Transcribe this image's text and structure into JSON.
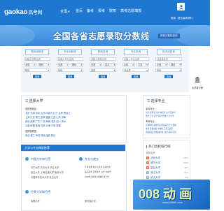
{
  "header": {
    "logo": "gaokao",
    "logo_suffix": "高考网",
    "region": "全国",
    "nav": [
      "首页",
      "备考",
      "报考",
      "院校",
      "高考志愿填报"
    ],
    "links": [
      "登录",
      "提交高考资料"
    ]
  },
  "banner": {
    "title": "全国各省志愿录取分数线",
    "tag": "院校分数线查询"
  },
  "search": {
    "columns": [
      {
        "tab": "院校分数线",
        "input": "请输入院校名称",
        "sel1": "全国",
        "sel2": "理科",
        "sel3": "年份",
        "btn": "查询"
      },
      {
        "tab": "专业分数线",
        "input": "请输入专业名称",
        "sel1": "全国",
        "sel2": "理科",
        "sel3": "年份",
        "btn": "查询"
      },
      {
        "tab": "院校查询",
        "input": "请输入院校名称",
        "sel1": "全国",
        "sel2": "层次",
        "sel3": "类型",
        "btn": "查询"
      },
      {
        "tab": "专业查询",
        "input": "请输入专业名称",
        "sel1": "本科",
        "sel2": "门类",
        "sel3": "专业类",
        "btn": "查询"
      },
      {
        "tab": "批次线查询",
        "input": "请选择省份",
        "sel1": "全国",
        "sel2": "理科",
        "sel3": "年份",
        "btn": "查询"
      }
    ],
    "side_tool_label": "大学排行榜"
  },
  "school_panel": {
    "title": "选择大学",
    "sub1": "按院校地区:",
    "row1": "北京 天津 河北 山西 内蒙古 辽宁 吉林 黑龙江",
    "row2": "上海 江苏 浙江 安徽 福建 江西 山东 河南",
    "row3": "湖北 湖南 广东 广西 海南 重庆 四川 贵州",
    "row4": "云南 西藏 陕西 甘肃 青海 宁夏 新疆",
    "sub2": "按院校类型:",
    "row5": "综合 理工 师范 财经 医药 政法"
  },
  "major_panel": {
    "title": "选择专业",
    "sub1": "本科专业:",
    "row1": "哲学 经济学 法学 教育学 文学 历史学",
    "row2": "理学 工学 农学 医学 管理学 艺术学",
    "sub2": "专科专业:",
    "row3": "农林牧渔 资源环境 能源动力 土木建筑",
    "row4": "水利 装备制造 生物化工 轻工纺织",
    "row5": "食品药品 交通运输 电子信息 医药卫生"
  },
  "section": {
    "title": "大学与专业精彩推荐",
    "card1": "中国大学排行榜",
    "card2": "专业与就业",
    "card3": "世界大学排行榜",
    "lines1": [
      "清华大学 北京大学 浙江大学",
      "复旦大学 上海交通大学 南京大学",
      "中国科学技术大学 武汉大学"
    ],
    "lines2": [
      "计算机类 电子信息类 自动化类",
      "临床医学 口腔医学 法学 金融学",
      "土木类 建筑类 机械类 会计学"
    ],
    "line3": "哈佛大学",
    "line4": "斯坦福大学"
  },
  "side_panel": {
    "title": "热门高校排行榜",
    "sub": "院校名称",
    "rows": [
      {
        "rank": "1",
        "name": "北京大学",
        "num": "1227"
      },
      {
        "rank": "2",
        "name": "清华大学",
        "num": "1082"
      },
      {
        "rank": "3",
        "name": "复旦大学",
        "num": "987"
      },
      {
        "rank": "4",
        "name": "浙江大学",
        "num": "892"
      },
      {
        "rank": "5",
        "name": "武汉大学",
        "num": "756"
      },
      {
        "rank": "6",
        "name": "厦门大学",
        "num": "694"
      },
      {
        "rank": "7",
        "name": "南京大学",
        "num": "633"
      },
      {
        "rank": "8",
        "name": "四川大学",
        "num": "588"
      },
      {
        "rank": "9",
        "name": "中山大学",
        "num": "541"
      }
    ]
  },
  "ad": {
    "text": "008 动 画",
    "sub": "www.008dh.com"
  }
}
